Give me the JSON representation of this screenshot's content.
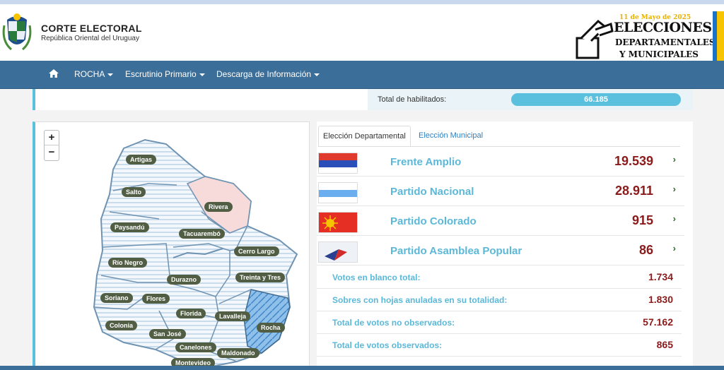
{
  "header": {
    "org_title": "CORTE ELECTORAL",
    "org_subtitle": "República Oriental del Uruguay",
    "banner": {
      "date": "11 de Mayo de 2025",
      "line1": "ELECCIONES",
      "line2": "DEPARTAMENTALES",
      "line3": "Y MUNICIPALES"
    }
  },
  "nav": {
    "home_icon": "home-icon",
    "items": [
      {
        "label": "ROCHA"
      },
      {
        "label": "Escrutinio Primario"
      },
      {
        "label": "Descarga de Información"
      }
    ]
  },
  "habilitados": {
    "label": "Total de habilitados:",
    "value": "66.185"
  },
  "map": {
    "zoom_in": "+",
    "zoom_out": "−",
    "departments": [
      "Artigas",
      "Salto",
      "Rivera",
      "Paysandú",
      "Tacuarembó",
      "Cerro Largo",
      "Río Negro",
      "Durazno",
      "Treinta y Tres",
      "Soriano",
      "Flores",
      "Florida",
      "Lavalleja",
      "Colonia",
      "San José",
      "Rocha",
      "Canelones",
      "Maldonado",
      "Montevideo"
    ],
    "highlighted": "Rocha"
  },
  "results": {
    "tabs": [
      "Elección Departamental",
      "Elección Municipal"
    ],
    "parties": [
      {
        "name": "Frente Amplio",
        "votes": "19.539"
      },
      {
        "name": "Partido Nacional",
        "votes": "28.911"
      },
      {
        "name": "Partido Colorado",
        "votes": "915"
      },
      {
        "name": "Partido Asamblea Popular",
        "votes": "86"
      }
    ],
    "stats": [
      {
        "label": "Votos en blanco total:",
        "value": "1.734"
      },
      {
        "label": "Sobres con hojas anuladas en su totalidad:",
        "value": "1.830"
      },
      {
        "label": "Total de votos no observados:",
        "value": "57.162"
      },
      {
        "label": "Total de votos observados:",
        "value": "865"
      }
    ]
  },
  "colors": {
    "nav": "#3b6f99",
    "accent": "#5bc0de",
    "value": "#8b1b1b",
    "label": "#5bb8d8"
  }
}
